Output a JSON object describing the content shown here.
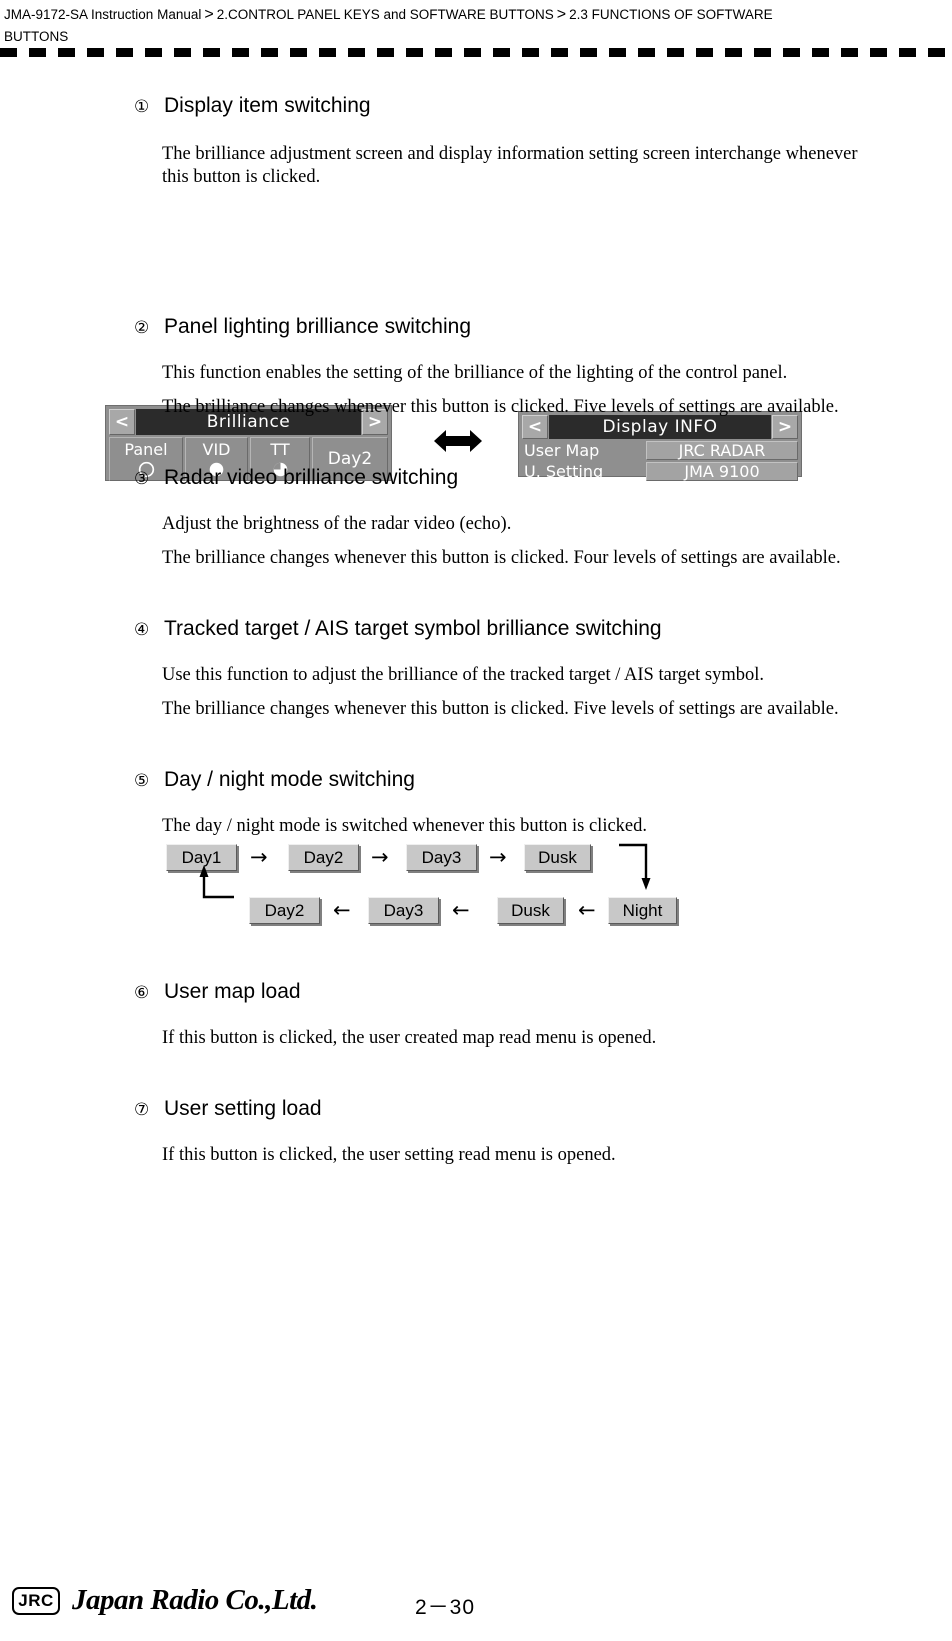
{
  "header": {
    "manual": "JMA-9172-SA Instruction Manual",
    "sep1": ">",
    "chapter": "2.CONTROL PANEL KEYS and SOFTWARE BUTTONS",
    "sep2": ">",
    "section": "2.3  FUNCTIONS OF SOFTWARE BUTTONS"
  },
  "sections": [
    {
      "num": "①",
      "title": "Display item switching",
      "paragraphs": [
        "The brilliance adjustment screen and display information setting screen interchange whenever this button is clicked."
      ]
    },
    {
      "num": "②",
      "title": "Panel lighting brilliance switching",
      "paragraphs": [
        "This function enables the setting of the brilliance of the lighting of the control panel.",
        "The brilliance changes whenever this button is clicked. Five levels of settings are available."
      ]
    },
    {
      "num": "③",
      "title": "Radar video brilliance switching",
      "paragraphs": [
        "Adjust the brightness of the radar video (echo).",
        "The brilliance changes whenever this button is clicked. Four levels of settings are available."
      ]
    },
    {
      "num": "④",
      "title": "Tracked target / AIS target symbol brilliance switching",
      "paragraphs": [
        "Use this function to adjust the brilliance of the tracked target / AIS target symbol.",
        "The brilliance changes whenever this button is clicked. Five levels of settings are available."
      ]
    },
    {
      "num": "⑤",
      "title": "Day / night mode switching",
      "paragraphs": [
        "The day / night mode is switched whenever this button is clicked."
      ]
    },
    {
      "num": "⑥",
      "title": "User map load",
      "paragraphs": [
        "If this button is clicked, the user created map read menu is opened."
      ]
    },
    {
      "num": "⑦",
      "title": "User setting load",
      "paragraphs": [
        "If this button is clicked, the user setting read menu is opened."
      ]
    }
  ],
  "brilliance_panel": {
    "left_arrow": "<",
    "title": "Brilliance",
    "right_arrow": ">",
    "keys": [
      {
        "label": "Panel",
        "gauge": "empty"
      },
      {
        "label": "VID",
        "gauge": "full"
      },
      {
        "label": "TT",
        "gauge": "three-quarter"
      }
    ],
    "mode_key": "Day2"
  },
  "interchange_symbol": "left-right-arrow",
  "display_info_panel": {
    "left_arrow": "<",
    "title": "Display  INFO",
    "right_arrow": ">",
    "rows": [
      {
        "label": "User Map",
        "value": "JRC RADAR"
      },
      {
        "label": "U. Setting",
        "value": "JMA 9100"
      }
    ]
  },
  "day_night_cycle": {
    "top_row": [
      {
        "label": "Day1"
      },
      {
        "label": "Day2"
      },
      {
        "label": "Day3"
      },
      {
        "label": "Dusk"
      }
    ],
    "top_arrows": [
      "→",
      "→",
      "→"
    ],
    "bottom_row": [
      {
        "label": "Day2"
      },
      {
        "label": "Day3"
      },
      {
        "label": "Dusk"
      },
      {
        "label": "Night"
      }
    ],
    "bottom_arrows": [
      "←",
      "←",
      "←"
    ],
    "wrap_right": "turn-down-arrow",
    "wrap_left": "turn-up-arrow"
  },
  "footer": {
    "logo_mark": "JRC",
    "company": "Japan Radio Co.,Ltd.",
    "page_number": "2－30"
  },
  "colors": {
    "lcd_body": "#8f8f8f",
    "lcd_titlebar": "#2b2b2b",
    "button_face": "#c8c8c8"
  }
}
